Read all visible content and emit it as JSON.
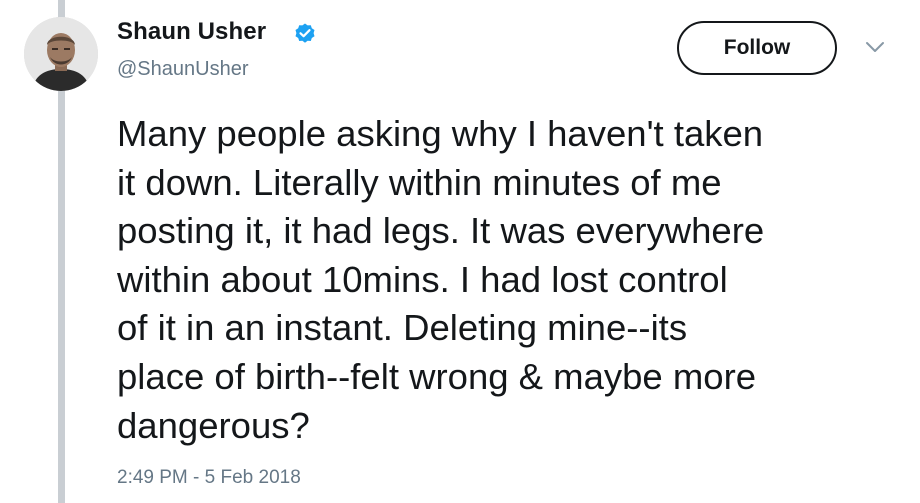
{
  "author": {
    "display_name": "Shaun Usher",
    "handle": "@ShaunUsher",
    "verified": true,
    "avatar_icon": "profile-photo"
  },
  "actions": {
    "follow_label": "Follow",
    "menu_icon": "chevron-down-icon"
  },
  "tweet": {
    "text_lines": [
      "Many people asking why I haven't taken",
      "it down. Literally within minutes of me",
      "posting it, it had legs. It was everywhere",
      "within about 10mins. I had lost control",
      "of it in an instant. Deleting mine--its",
      "place of birth--felt wrong & maybe more",
      "dangerous?"
    ],
    "timestamp": "2:49 PM - 5 Feb 2018"
  },
  "colors": {
    "text_primary": "#14171a",
    "text_secondary": "#657786",
    "verified_blue": "#1da1f2",
    "thread_line": "#c9ced3"
  }
}
